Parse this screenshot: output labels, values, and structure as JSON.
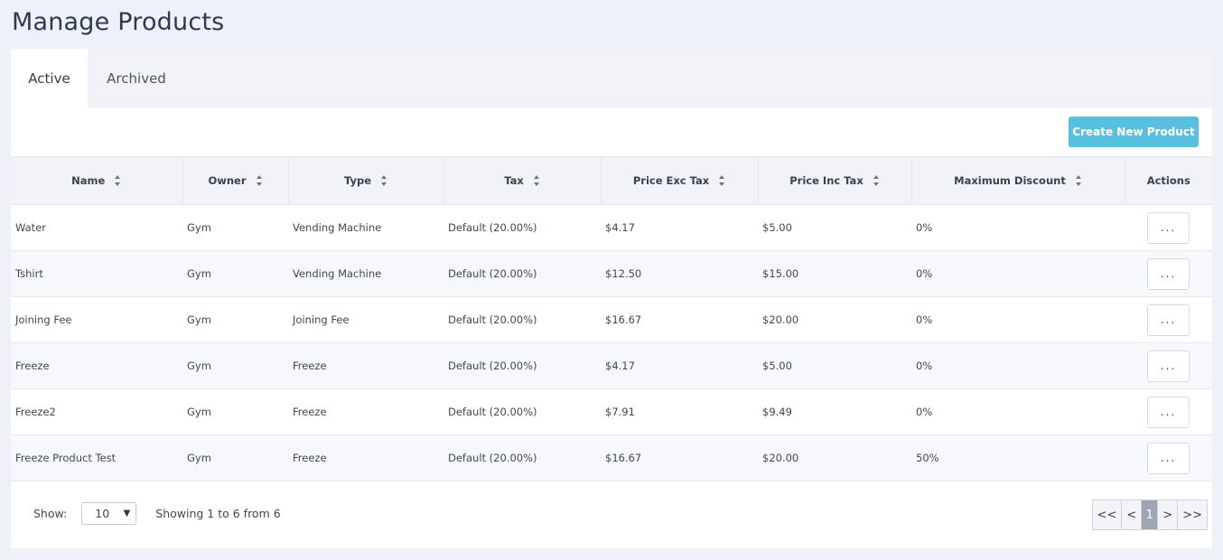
{
  "page": {
    "title": "Manage Products"
  },
  "tabs": [
    {
      "label": "Active",
      "active": true
    },
    {
      "label": "Archived",
      "active": false
    }
  ],
  "toolbar": {
    "create_label": "Create New Product",
    "create_color": "#58bfdc"
  },
  "table": {
    "columns": [
      "Name",
      "Owner",
      "Type",
      "Tax",
      "Price Exc Tax",
      "Price Inc Tax",
      "Maximum Discount",
      "Actions"
    ],
    "rows": [
      {
        "name": "Water",
        "owner": "Gym",
        "type": "Vending Machine",
        "tax": "Default (20.00%)",
        "price_exc": "$4.17",
        "price_inc": "$5.00",
        "discount": "0%",
        "action": "..."
      },
      {
        "name": "Tshirt",
        "owner": "Gym",
        "type": "Vending Machine",
        "tax": "Default (20.00%)",
        "price_exc": "$12.50",
        "price_inc": "$15.00",
        "discount": "0%",
        "action": "..."
      },
      {
        "name": "Joining Fee",
        "owner": "Gym",
        "type": "Joining Fee",
        "tax": "Default (20.00%)",
        "price_exc": "$16.67",
        "price_inc": "$20.00",
        "discount": "0%",
        "action": "..."
      },
      {
        "name": "Freeze",
        "owner": "Gym",
        "type": "Freeze",
        "tax": "Default (20.00%)",
        "price_exc": "$4.17",
        "price_inc": "$5.00",
        "discount": "0%",
        "action": "..."
      },
      {
        "name": "Freeze2",
        "owner": "Gym",
        "type": "Freeze",
        "tax": "Default (20.00%)",
        "price_exc": "$7.91",
        "price_inc": "$9.49",
        "discount": "0%",
        "action": "..."
      },
      {
        "name": "Freeze Product Test",
        "owner": "Gym",
        "type": "Freeze",
        "tax": "Default (20.00%)",
        "price_exc": "$16.67",
        "price_inc": "$20.00",
        "discount": "50%",
        "action": "..."
      }
    ]
  },
  "footer": {
    "show_label": "Show:",
    "page_size": "10",
    "showing_text": "Showing 1 to 6 from 6",
    "pager": {
      "first": "<<",
      "prev": "<",
      "current": "1",
      "next": ">",
      "last": ">>"
    }
  },
  "icons": {
    "sort": "sort-icon",
    "select_arrow": "chevron-down-icon"
  }
}
